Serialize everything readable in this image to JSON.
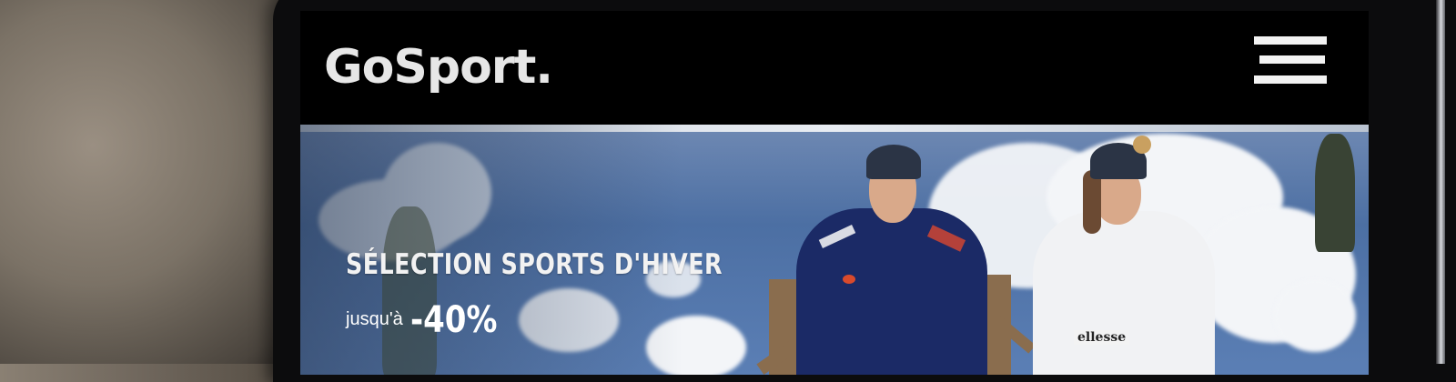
{
  "brand": {
    "logo": "GoSport."
  },
  "header": {
    "menu_icon": "hamburger-menu-icon"
  },
  "hero": {
    "headline": "SÉLECTION SPORTS D'HIVER",
    "discount_prefix": "jusqu'à",
    "discount_value": "-40%",
    "jacket_brand": "ellesse"
  },
  "colors": {
    "topbar": "#000000",
    "sky": "#4c6fa3",
    "logo_text": "#e7e7e7",
    "man_jacket": "#1b2a66",
    "woman_jacket": "#f1f2f4",
    "beanie": "#2b3445"
  }
}
